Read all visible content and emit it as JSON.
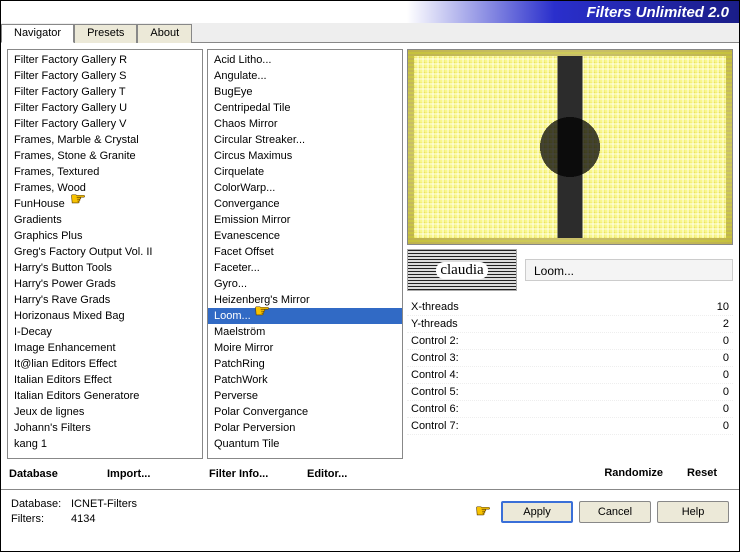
{
  "title": "Filters Unlimited 2.0",
  "tabs": [
    {
      "label": "Navigator",
      "active": true
    },
    {
      "label": "Presets",
      "active": false
    },
    {
      "label": "About",
      "active": false
    }
  ],
  "left_list": [
    "Filter Factory Gallery R",
    "Filter Factory Gallery S",
    "Filter Factory Gallery T",
    "Filter Factory Gallery U",
    "Filter Factory Gallery V",
    "Frames, Marble & Crystal",
    "Frames, Stone & Granite",
    "Frames, Textured",
    "Frames, Wood",
    "FunHouse",
    "Gradients",
    "Graphics Plus",
    "Greg's Factory Output Vol. II",
    "Harry's Button Tools",
    "Harry's Power Grads",
    "Harry's Rave Grads",
    "Horizonaus Mixed Bag",
    "I-Decay",
    "Image Enhancement",
    "It@lian Editors Effect",
    "Italian Editors Effect",
    "Italian Editors Generatore",
    "Jeux de lignes",
    "Johann's Filters",
    "kang 1"
  ],
  "left_highlight_index": 9,
  "mid_list": [
    "Acid Litho...",
    "Angulate...",
    "BugEye",
    "Centripedal Tile",
    "Chaos Mirror",
    "Circular Streaker...",
    "Circus Maximus",
    "Cirquelate",
    "ColorWarp...",
    "Convergance",
    "Emission Mirror",
    "Evanescence",
    "Facet Offset",
    "Faceter...",
    "Gyro...",
    "Heizenberg's Mirror",
    "Loom...",
    "Maelström",
    "Moire Mirror",
    "PatchRing",
    "PatchWork",
    "Perverse",
    "Polar Convergance",
    "Polar Perversion",
    "Quantum Tile"
  ],
  "mid_selected_index": 16,
  "left_buttons": {
    "database": "Database",
    "import": "Import..."
  },
  "mid_buttons": {
    "filter_info": "Filter Info...",
    "editor": "Editor..."
  },
  "logo_text": "claudia",
  "selected_filter_name": "Loom...",
  "params": [
    {
      "label": "X-threads",
      "value": "10"
    },
    {
      "label": "Y-threads",
      "value": "2"
    },
    {
      "label": "Control 2:",
      "value": "0"
    },
    {
      "label": "Control 3:",
      "value": "0"
    },
    {
      "label": "Control 4:",
      "value": "0"
    },
    {
      "label": "Control 5:",
      "value": "0"
    },
    {
      "label": "Control 6:",
      "value": "0"
    },
    {
      "label": "Control 7:",
      "value": "0"
    }
  ],
  "randomize_label": "Randomize",
  "reset_label": "Reset",
  "footer": {
    "database_label": "Database:",
    "database_value": "ICNET-Filters",
    "filters_label": "Filters:",
    "filters_value": "4134"
  },
  "buttons": {
    "apply": "Apply",
    "cancel": "Cancel",
    "help": "Help"
  }
}
